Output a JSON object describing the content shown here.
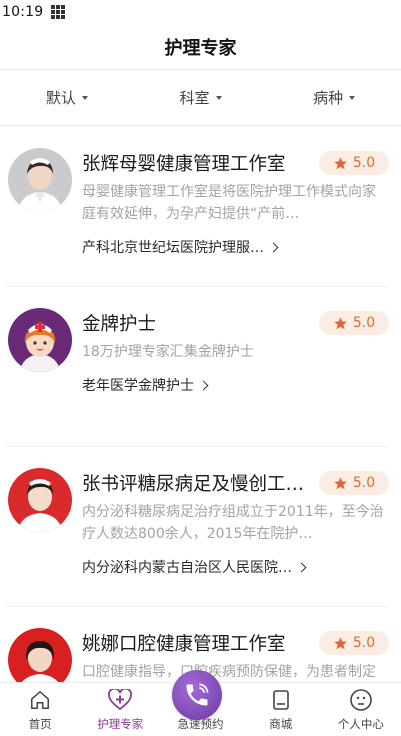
{
  "status": {
    "time": "10:19"
  },
  "header": {
    "title": "护理专家"
  },
  "filters": [
    {
      "label": "默认"
    },
    {
      "label": "科室"
    },
    {
      "label": "病种"
    }
  ],
  "experts": [
    {
      "title": "张辉母婴健康管理工作室",
      "rating": "5.0",
      "desc": "母婴健康管理工作室是将医院护理工作模式向家庭有效延伸，为孕产妇提供“产前…",
      "dept": "产科北京世纪坛医院护理服…"
    },
    {
      "title": "金牌护士",
      "rating": "5.0",
      "desc": "18万护理专家汇集金牌护士",
      "dept": "老年医学金牌护士"
    },
    {
      "title": "张书评糖尿病足及慢创工…",
      "rating": "5.0",
      "desc": "内分泌科糖尿病足治疗组成立于2011年，至今治疗人数达800余人，2015年在院护…",
      "dept": "内分泌科内蒙古自治区人民医院…"
    },
    {
      "title": "姚娜口腔健康管理工作室",
      "rating": "5.0",
      "desc": "口腔健康指导，口腔疾病预防保健，为患者制定个性化口腔健康指导，包括建立…",
      "dept": ""
    }
  ],
  "tabs": [
    {
      "label": "首页",
      "icon": "home-icon"
    },
    {
      "label": "护理专家",
      "icon": "heart-plus-icon"
    },
    {
      "label": "急速预约",
      "icon": "phone-icon"
    },
    {
      "label": "商城",
      "icon": "book-icon"
    },
    {
      "label": "个人中心",
      "icon": "face-icon"
    }
  ],
  "colors": {
    "accent": "#8a3d98",
    "rating": "#e3672c",
    "rating_bg": "#fdece4"
  }
}
